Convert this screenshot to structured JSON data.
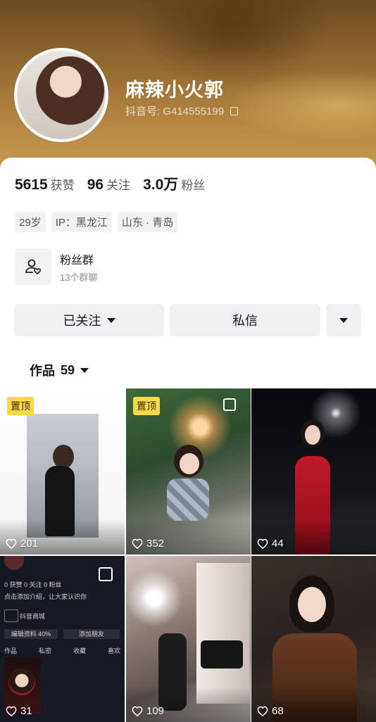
{
  "profile": {
    "nickname": "麻辣小火郭",
    "douyin_id": "抖音号: G414555199",
    "icons": {
      "copy": "copy-icon"
    }
  },
  "stats": [
    {
      "num": "5615",
      "label": "获赞"
    },
    {
      "num": "96",
      "label": "关注"
    },
    {
      "num": "3.0万",
      "label": "粉丝"
    }
  ],
  "tags": [
    "29岁",
    "IP：黑龙江",
    "山东 · 青岛"
  ],
  "fan_group": {
    "title": "粉丝群",
    "subtitle": "13个群聊",
    "icon": "users-heart-icon"
  },
  "actions": {
    "following": "已关注",
    "message": "私信"
  },
  "works_tab": {
    "label": "作品",
    "count": "59"
  },
  "grid": [
    {
      "likes": "201",
      "pinned": "置顶"
    },
    {
      "likes": "352",
      "pinned": "置顶"
    },
    {
      "likes": "44",
      "pinned": ""
    },
    {
      "likes": "31",
      "pinned": ""
    },
    {
      "likes": "109",
      "pinned": ""
    },
    {
      "likes": "68",
      "pinned": ""
    }
  ],
  "mini_profile": {
    "stats_line": "0 获赞   0 关注   0 粉丝",
    "tip": "点击添加介绍，让大家认识你",
    "shop": "抖音商城",
    "add_friend": "添加朋友",
    "edit": "编辑资料 40%",
    "tabs": [
      "作品",
      "私密",
      "收藏",
      "喜欢"
    ]
  },
  "colors": {
    "pin": "#fad84a",
    "button_bg": "#f0f0f2",
    "text": "#161823"
  }
}
